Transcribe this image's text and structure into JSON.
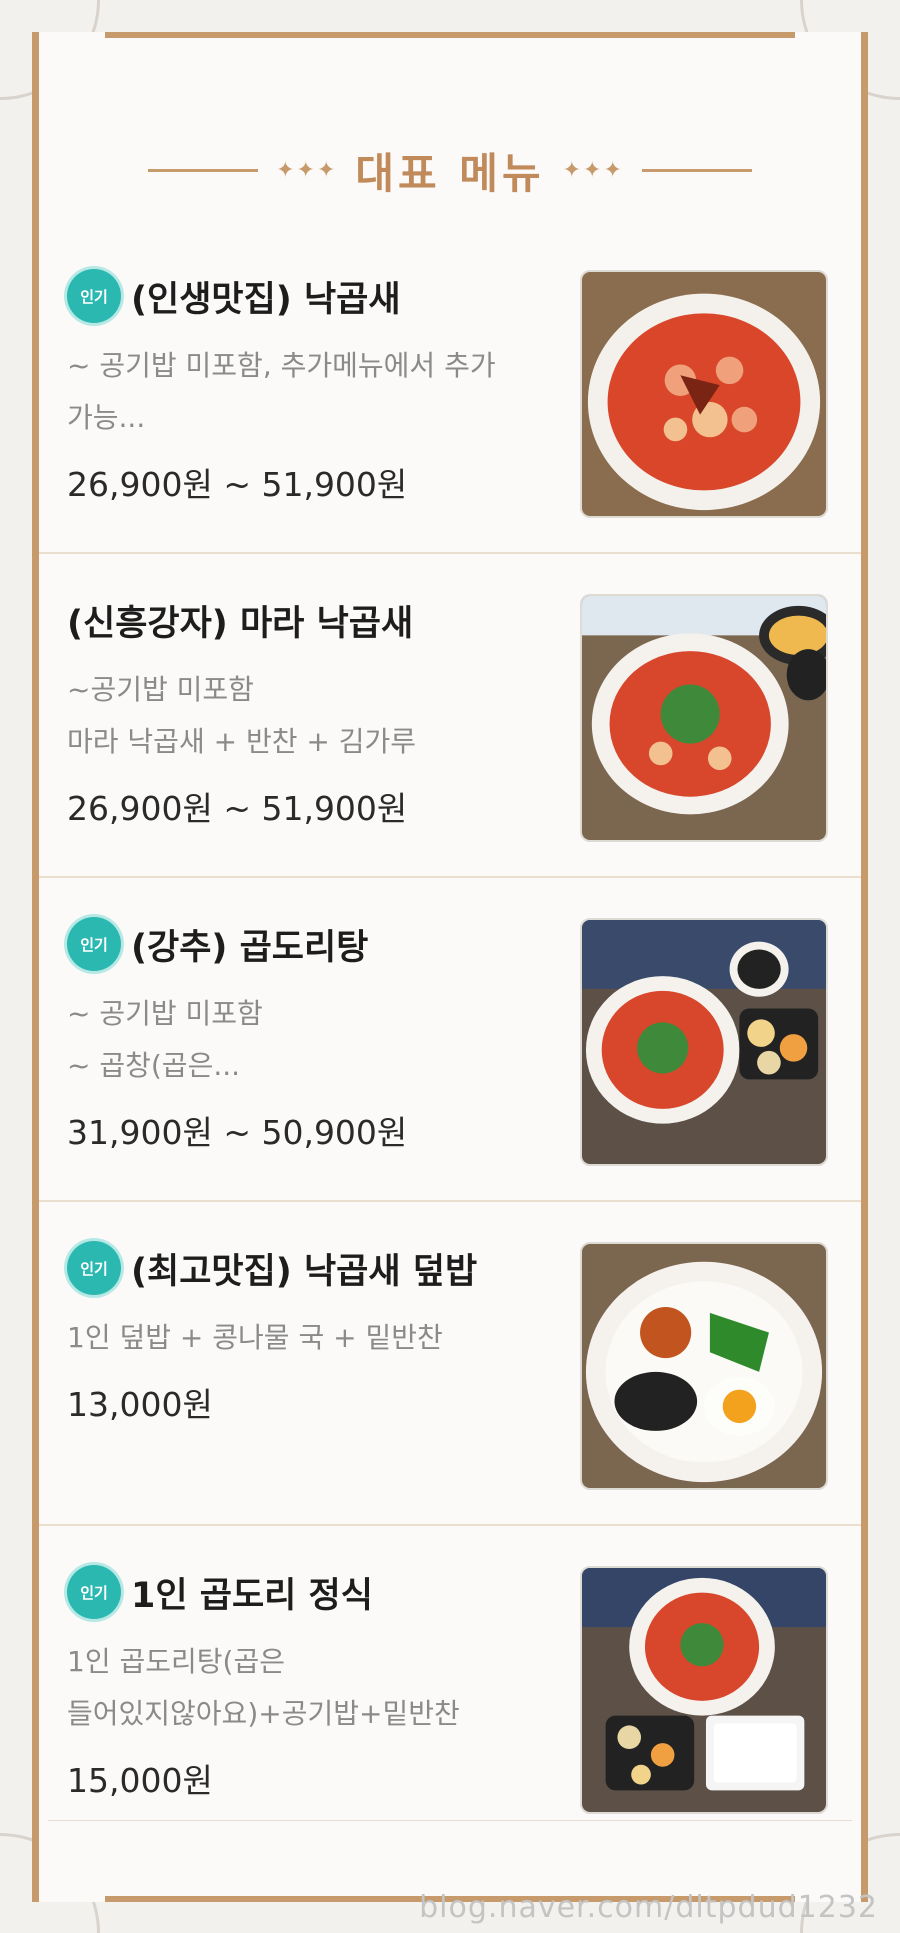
{
  "header": {
    "title": "대표 메뉴",
    "diamonds": "✦✦✦"
  },
  "items": [
    {
      "badge": "인기",
      "name": "(인생맛집)  낙곱새",
      "desc_lines": [
        "~ 공기밥 미포함, 추가메뉴에서 추가",
        "가능..."
      ],
      "price": "26,900원 ~ 51,900원",
      "image": "nakgopsae-bowl"
    },
    {
      "badge": "",
      "name": "(신흥강자) 마라 낙곱새",
      "desc_lines": [
        "~공기밥 미포함",
        "마라 낙곱새 + 반찬 + 김가루"
      ],
      "price": "26,900원 ~ 51,900원",
      "image": "mala-nakgopsae-bowl"
    },
    {
      "badge": "인기",
      "name": "(강추) 곱도리탕",
      "desc_lines": [
        "~ 공기밥 미포함",
        "~ 곱창(곱은..."
      ],
      "price": "31,900원 ~ 50,900원",
      "image": "gopdoritang-set"
    },
    {
      "badge": "인기",
      "name": "(최고맛집)  낙곱새 덮밥",
      "desc_lines": [
        "1인 덮밥 + 콩나물 국 + 밑반찬"
      ],
      "price": "13,000원",
      "image": "rice-bowl-with-egg"
    },
    {
      "badge": "인기",
      "name": "1인 곱도리 정식",
      "desc_lines": [
        "1인 곱도리탕(곱은",
        "들어있지않아요)+공기밥+밑반찬"
      ],
      "price": "15,000원",
      "image": "single-gopdori-set"
    }
  ],
  "watermark": "blog.naver.com/dltpdud1232"
}
